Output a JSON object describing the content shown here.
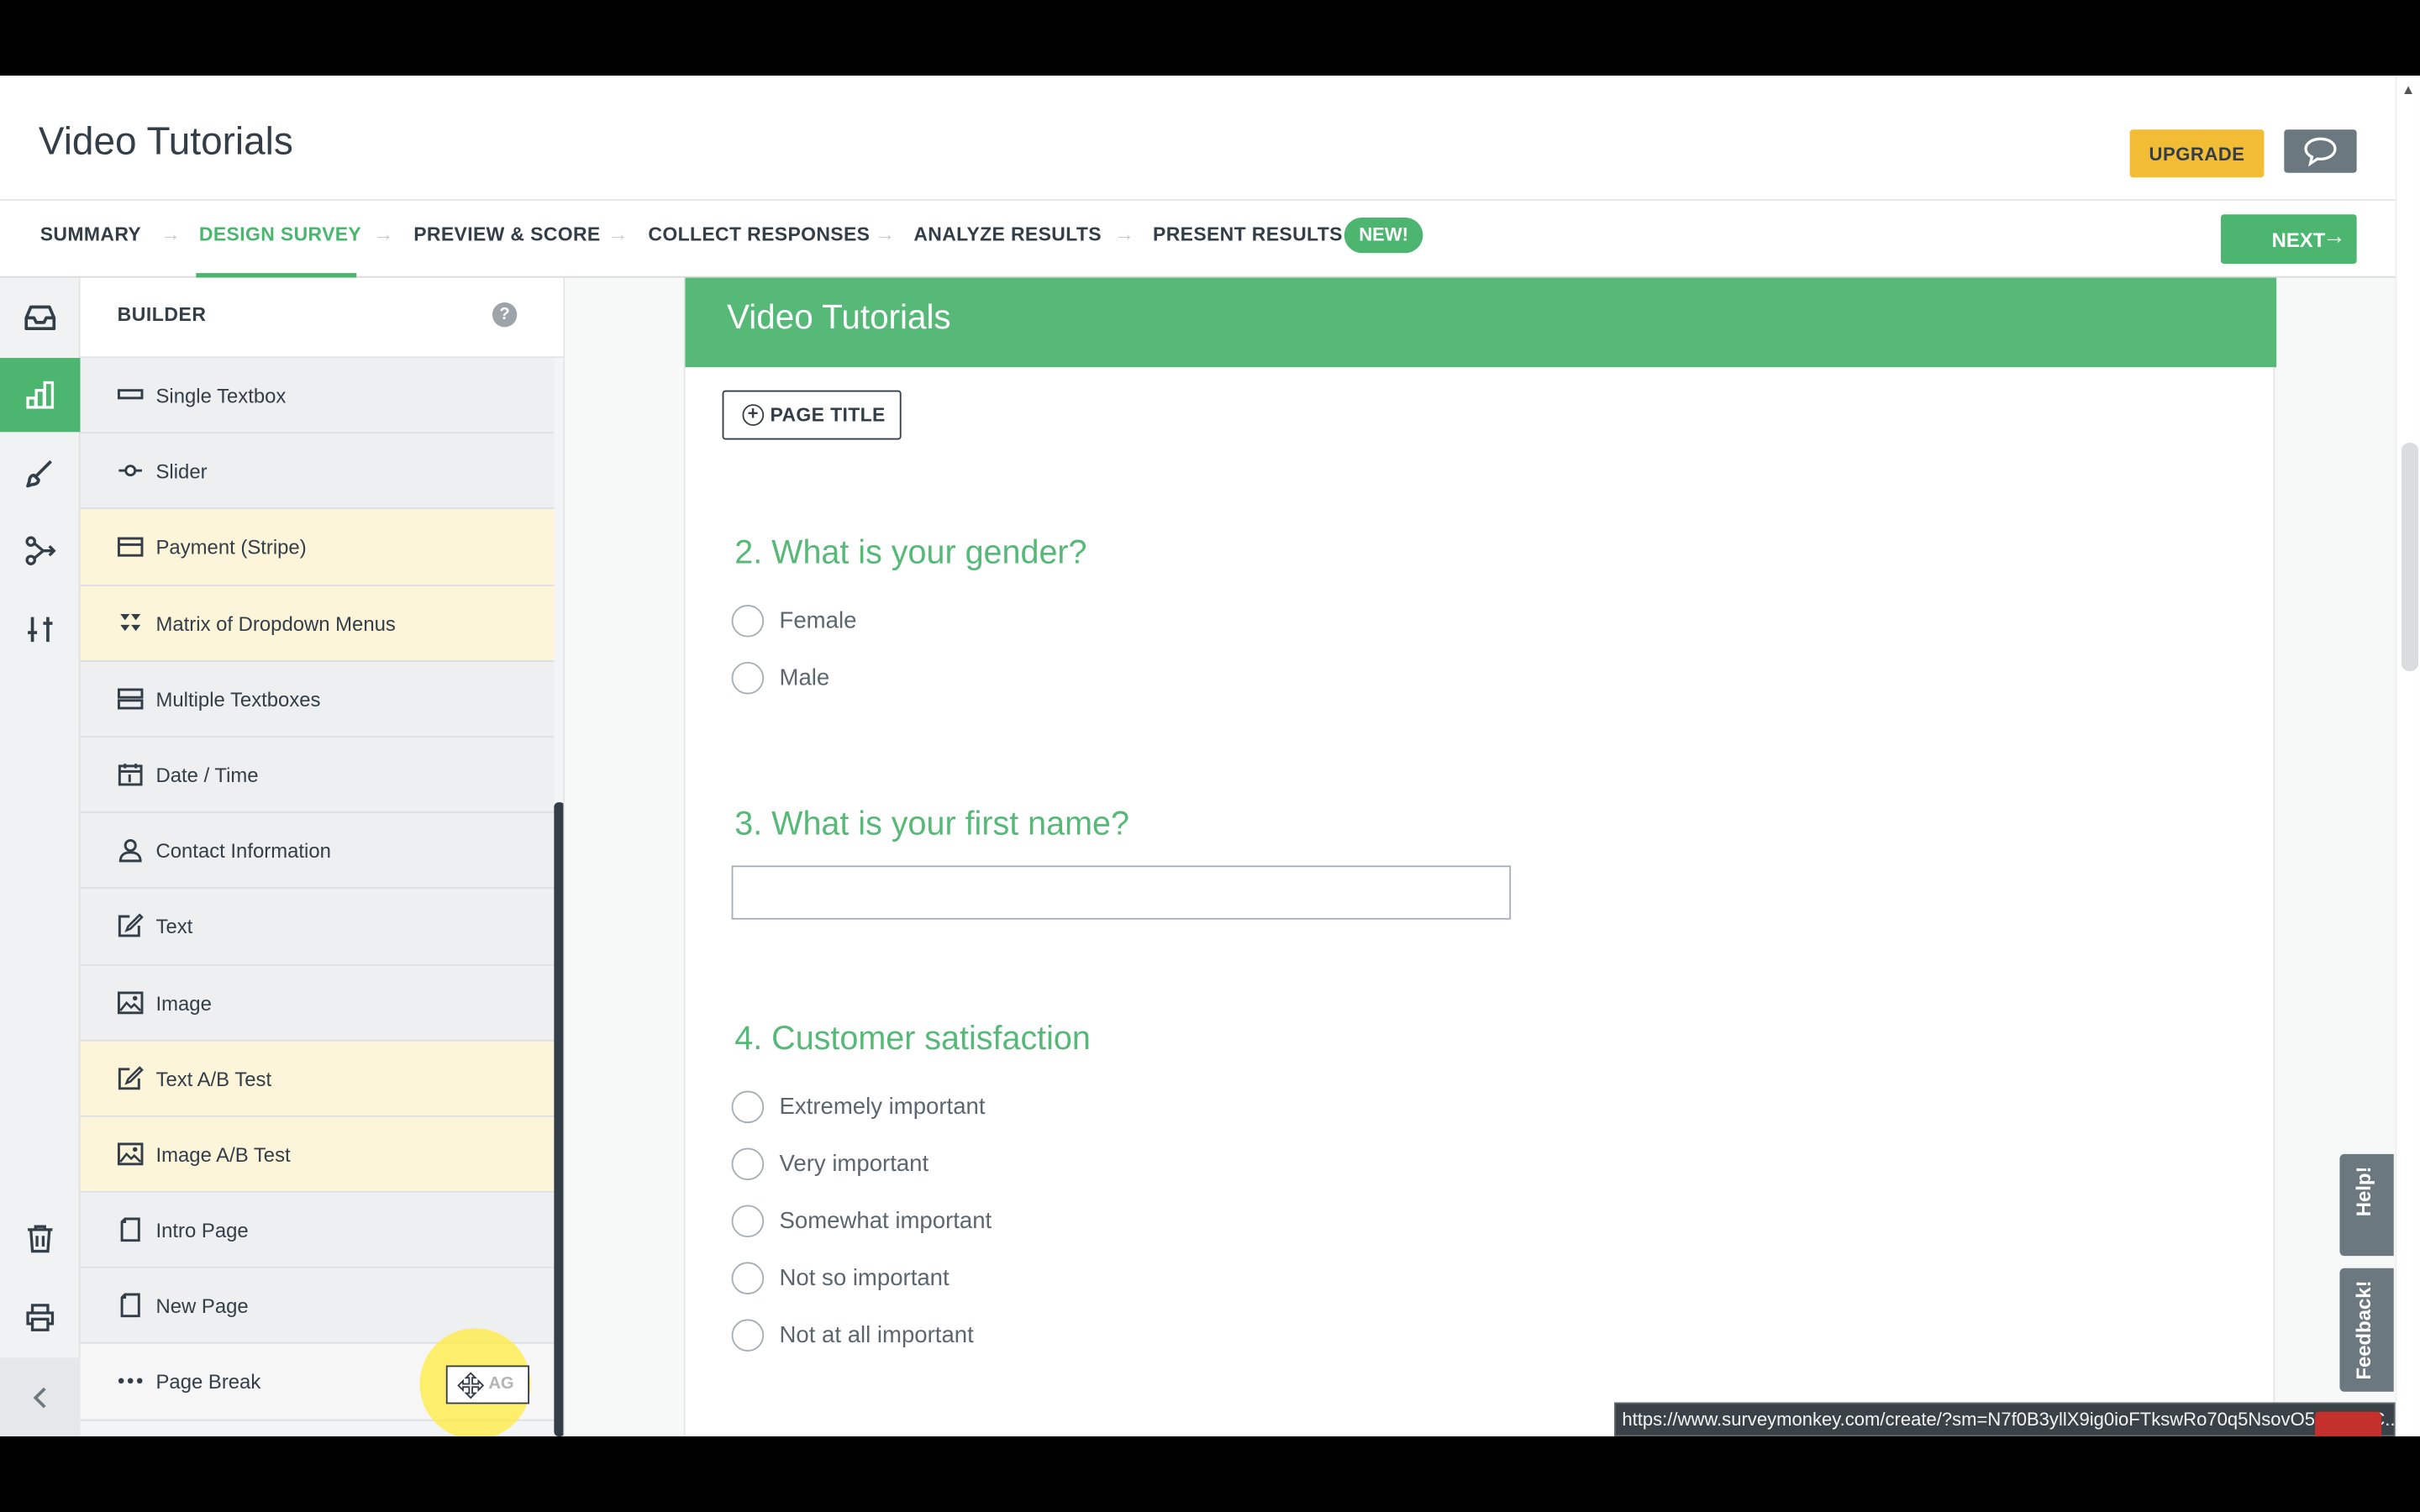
{
  "header": {
    "survey_title": "Video Tutorials",
    "upgrade_label": "UPGRADE"
  },
  "nav": {
    "steps": [
      {
        "label": "SUMMARY",
        "active": false
      },
      {
        "label": "DESIGN SURVEY",
        "active": true
      },
      {
        "label": "PREVIEW & SCORE",
        "active": false
      },
      {
        "label": "COLLECT RESPONSES",
        "active": false
      },
      {
        "label": "ANALYZE RESULTS",
        "active": false
      },
      {
        "label": "PRESENT RESULTS",
        "active": false
      }
    ],
    "new_badge": "NEW!",
    "next_label": "NEXT"
  },
  "rail": {
    "icons": [
      "inbox-icon",
      "builder-icon",
      "brush-icon",
      "logic-icon",
      "options-icon",
      "trash-icon",
      "print-icon",
      "collapse-chevron-icon"
    ],
    "active": "builder-icon"
  },
  "builder": {
    "title": "BUILDER",
    "help_glyph": "?",
    "items": [
      {
        "label": "Single Textbox",
        "icon": "single-textbox-icon",
        "premium": false
      },
      {
        "label": "Slider",
        "icon": "slider-icon",
        "premium": false
      },
      {
        "label": "Payment (Stripe)",
        "icon": "payment-card-icon",
        "premium": true
      },
      {
        "label": "Matrix of Dropdown Menus",
        "icon": "matrix-dropdown-icon",
        "premium": true
      },
      {
        "label": "Multiple Textboxes",
        "icon": "multiple-textboxes-icon",
        "premium": false
      },
      {
        "label": "Date / Time",
        "icon": "calendar-icon",
        "premium": false
      },
      {
        "label": "Contact Information",
        "icon": "contact-person-icon",
        "premium": false
      },
      {
        "label": "Text",
        "icon": "text-edit-icon",
        "premium": false
      },
      {
        "label": "Image",
        "icon": "image-icon",
        "premium": false
      },
      {
        "label": "Text A/B Test",
        "icon": "text-edit-icon",
        "premium": true
      },
      {
        "label": "Image A/B Test",
        "icon": "image-icon",
        "premium": true
      },
      {
        "label": "Intro Page",
        "icon": "page-icon",
        "premium": false
      },
      {
        "label": "New Page",
        "icon": "page-icon",
        "premium": false
      },
      {
        "label": "Page Break",
        "icon": "ellipsis-icon",
        "premium": false
      }
    ],
    "drag_label": "AG"
  },
  "survey": {
    "page_banner_title": "Video Tutorials",
    "page_title_button": "PAGE TITLE",
    "questions": [
      {
        "title": "2. What is your gender?",
        "options": [
          "Female",
          "Male"
        ]
      },
      {
        "title": "3. What is your first name?"
      },
      {
        "title": "4. Customer satisfaction",
        "options": [
          "Extremely important",
          "Very important",
          "Somewhat important",
          "Not so important",
          "Not at all important"
        ]
      }
    ]
  },
  "side_tabs": {
    "help": "Help!",
    "feedback": "Feedback!"
  },
  "status_url": "https://www.surveymonkey.com/create/?sm=N7f0B3yllX9ig0ioFTkswRo70q5NsovO5RokXZC..."
}
